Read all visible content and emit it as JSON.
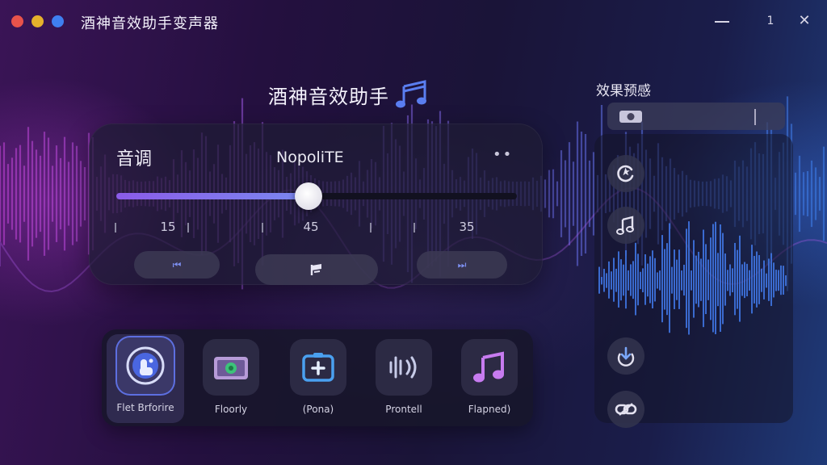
{
  "window": {
    "title": "酒神音效助手变声器",
    "controls": {
      "minimize": "",
      "maximize": "1",
      "close": "✕"
    }
  },
  "header": {
    "title": "酒神音效助手",
    "icon": "music-note-icon"
  },
  "pitch": {
    "label": "音调",
    "preset_name": "NopoliTE",
    "more": "••",
    "slider_value_fraction": 0.48,
    "tick_labels": [
      "15",
      "45",
      "35"
    ],
    "buttons": {
      "prev": "⏮",
      "mid": "flag-icon",
      "next": "⏭"
    }
  },
  "effects": {
    "selected_index": 0,
    "items": [
      {
        "label": "Flet Brforire",
        "icon": "touch-hand-icon"
      },
      {
        "label": "Floorly",
        "icon": "camera-icon"
      },
      {
        "label": "(Pona)",
        "icon": "add-box-icon"
      },
      {
        "label": "Prontell",
        "icon": "sound-waves-icon"
      },
      {
        "label": "Flapned)",
        "icon": "music-note-icon"
      }
    ]
  },
  "preview": {
    "title": "效果预感",
    "side_icons": [
      "camera-icon",
      "refresh-star-icon",
      "music-note-icon",
      "download-icon",
      "link-icon"
    ]
  },
  "colors": {
    "accent_purple": "#8b5ce8",
    "accent_blue": "#3d6fe8",
    "panel": "#1e1c34"
  }
}
